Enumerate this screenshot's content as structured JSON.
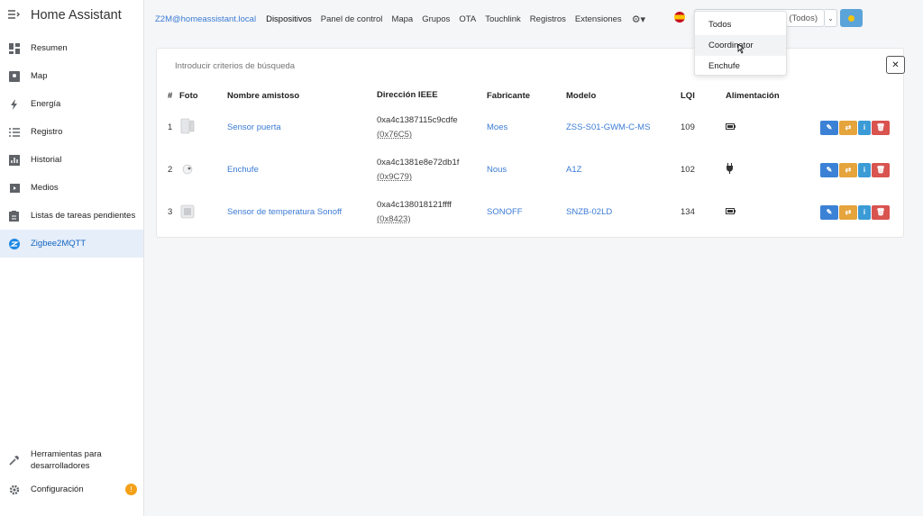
{
  "app": {
    "title": "Home Assistant"
  },
  "sidebar": {
    "items": [
      {
        "label": "Resumen",
        "icon": "dashboard-icon"
      },
      {
        "label": "Map",
        "icon": "map-icon"
      },
      {
        "label": "Energía",
        "icon": "lightning-icon"
      },
      {
        "label": "Registro",
        "icon": "list-icon"
      },
      {
        "label": "Historial",
        "icon": "chart-icon"
      },
      {
        "label": "Medios",
        "icon": "media-icon"
      },
      {
        "label": "Listas de tareas pendientes",
        "icon": "checklist-icon"
      },
      {
        "label": "Zigbee2MQTT",
        "icon": "zigbee-icon",
        "active": true
      }
    ],
    "bottom": [
      {
        "label": "Herramientas para desarrolladores",
        "icon": "hammer-icon"
      },
      {
        "label": "Configuración",
        "icon": "gear-icon",
        "badge": "!"
      }
    ]
  },
  "topnav": {
    "brand": "Z2M@homeassistant.local",
    "links": [
      "Dispositivos",
      "Panel de control",
      "Mapa",
      "Grupos",
      "OTA",
      "Touchlink",
      "Registros",
      "Extensiones"
    ],
    "active": "Dispositivos"
  },
  "permit_select": {
    "value": "(Todos)"
  },
  "dropdown": {
    "options": [
      "Todos",
      "Coordinator",
      "Enchufe"
    ],
    "hovered": "Coordinator"
  },
  "search": {
    "placeholder": "Introducir criterios de búsqueda",
    "value": ""
  },
  "table": {
    "headers": [
      "#",
      "Foto",
      "Nombre amistoso",
      "Dirección IEEE",
      "Fabricante",
      "Modelo",
      "LQI",
      "Alimentación"
    ],
    "rows": [
      {
        "n": "1",
        "name": "Sensor puerta",
        "ieee": "0xa4c1387115c9cdfe",
        "nwk": "(0x76C5)",
        "mfr": "Moes",
        "model": "ZSS-S01-GWM-C-MS",
        "lqi": "109",
        "power": "battery-icon"
      },
      {
        "n": "2",
        "name": "Enchufe",
        "ieee": "0xa4c1381e8e72db1f",
        "nwk": "(0x9C79)",
        "mfr": "Nous",
        "model": "A1Z",
        "lqi": "102",
        "power": "plug-icon"
      },
      {
        "n": "3",
        "name": "Sensor de temperatura Sonoff",
        "ieee": "0xa4c138018121ffff",
        "nwk": "(0x8423)",
        "mfr": "SONOFF",
        "model": "SNZB-02LD",
        "lqi": "134",
        "power": "battery-icon"
      }
    ]
  },
  "colors": {
    "accent": "#3b7bd4",
    "active_bg": "#e6eef9",
    "edit": "#3b82d6",
    "rename": "#e5a43c",
    "delete": "#d9534f",
    "badge": "#f4a11a"
  }
}
